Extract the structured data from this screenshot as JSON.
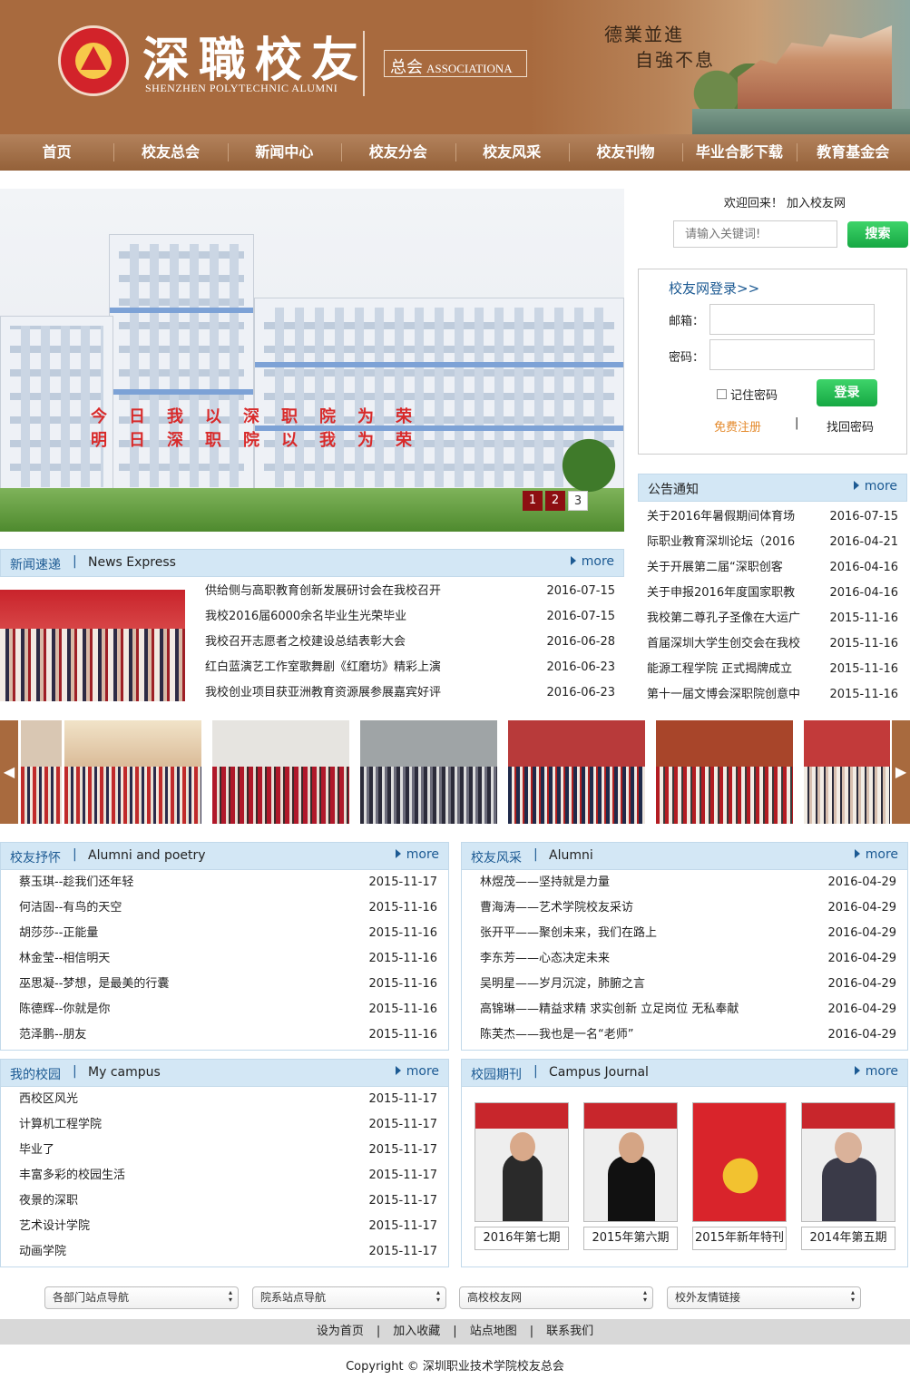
{
  "header": {
    "site_title": "深職校友",
    "site_subtitle": "SHENZHEN POLYTECHNIC ALUMNI",
    "assoc_zh": "总会",
    "assoc_en": "ASSOCIATIONA",
    "motto_line1": "德業並進",
    "motto_line2": "自強不息"
  },
  "nav": [
    "首页",
    "校友总会",
    "新闻中心",
    "校友分会",
    "校友风采",
    "校友刊物",
    "毕业合影下载",
    "教育基金会"
  ],
  "slider": {
    "slogan_line1": "今日我以深职院为荣",
    "slogan_line2": "明日深职院以我为荣",
    "pages": [
      "1",
      "2",
      "3"
    ],
    "active_page": "2"
  },
  "sidebar": {
    "welcome": "欢迎回来！ 加入校友网",
    "search_placeholder": "请输入关键词!",
    "search_button": "搜索",
    "login_title": "校友网登录>>",
    "email_label": "邮箱：",
    "password_label": "密码：",
    "remember_label": "记住密码",
    "login_button": "登录",
    "register_link": "免费注册",
    "separator": "|",
    "forgot_link": "找回密码"
  },
  "notice": {
    "title": "公告通知",
    "more": "more",
    "items": [
      {
        "title": "关于2016年暑假期间体育场",
        "date": "2016-07-15"
      },
      {
        "title": "际职业教育深圳论坛（2016",
        "date": "2016-04-21"
      },
      {
        "title": "关于开展第二届“深职创客",
        "date": "2016-04-16"
      },
      {
        "title": "关于申报2016年度国家职教",
        "date": "2016-04-16"
      },
      {
        "title": "我校第二尊孔子圣像在大运广",
        "date": "2015-11-16"
      },
      {
        "title": "首届深圳大学生创交会在我校",
        "date": "2015-11-16"
      },
      {
        "title": "能源工程学院 正式揭牌成立",
        "date": "2015-11-16"
      },
      {
        "title": "第十一届文博会深职院创意中",
        "date": "2015-11-16"
      }
    ]
  },
  "news": {
    "title_zh": "新闻速递",
    "separator": "|",
    "title_en": "News Express",
    "more": "more",
    "items": [
      {
        "title": "供给侧与高职教育创新发展研讨会在我校召开",
        "date": "2016-07-15"
      },
      {
        "title": "我校2016届6000余名毕业生光荣毕业",
        "date": "2016-07-15"
      },
      {
        "title": "我校召开志愿者之校建设总结表彰大会",
        "date": "2016-06-28"
      },
      {
        "title": "红白蓝演艺工作室歌舞剧《红磨坊》精彩上演",
        "date": "2016-06-23"
      },
      {
        "title": "我校创业项目获亚洲教育资源展参展嘉宾好评",
        "date": "2016-06-23"
      }
    ]
  },
  "gallery": {
    "left_arrow": "◀",
    "right_arrow": "▶"
  },
  "poetry": {
    "title_zh": "校友抒怀",
    "separator": "|",
    "title_en": "Alumni and poetry",
    "more": "more",
    "items": [
      {
        "title": "蔡玉琪--趁我们还年轻",
        "date": "2015-11-17"
      },
      {
        "title": "何洁固--有鸟的天空",
        "date": "2015-11-16"
      },
      {
        "title": "胡莎莎--正能量",
        "date": "2015-11-16"
      },
      {
        "title": "林金莹--相信明天",
        "date": "2015-11-16"
      },
      {
        "title": "巫思凝--梦想，是最美的行囊",
        "date": "2015-11-16"
      },
      {
        "title": "陈德辉--你就是你",
        "date": "2015-11-16"
      },
      {
        "title": "范泽鹏--朋友",
        "date": "2015-11-16"
      }
    ]
  },
  "alumni": {
    "title_zh": "校友风采",
    "separator": "|",
    "title_en": "Alumni",
    "more": "more",
    "items": [
      {
        "title": "林煜茂——坚持就是力量",
        "date": "2016-04-29"
      },
      {
        "title": "曹海涛——艺术学院校友采访",
        "date": "2016-04-29"
      },
      {
        "title": "张开平——聚创未来，我们在路上",
        "date": "2016-04-29"
      },
      {
        "title": "李东芳——心态决定未来",
        "date": "2016-04-29"
      },
      {
        "title": "吴明星——岁月沉淀，肺腑之言",
        "date": "2016-04-29"
      },
      {
        "title": "高锦琳——精益求精 求实创新 立足岗位 无私奉献",
        "date": "2016-04-29"
      },
      {
        "title": "陈芙杰——我也是一名“老师”",
        "date": "2016-04-29"
      }
    ]
  },
  "campus": {
    "title_zh": "我的校园",
    "separator": "|",
    "title_en": "My campus",
    "more": "more",
    "items": [
      {
        "title": "西校区风光",
        "date": "2015-11-17"
      },
      {
        "title": "计算机工程学院",
        "date": "2015-11-17"
      },
      {
        "title": "毕业了",
        "date": "2015-11-17"
      },
      {
        "title": "丰富多彩的校园生活",
        "date": "2015-11-17"
      },
      {
        "title": "夜景的深职",
        "date": "2015-11-17"
      },
      {
        "title": "艺术设计学院",
        "date": "2015-11-17"
      },
      {
        "title": "动画学院",
        "date": "2015-11-17"
      }
    ]
  },
  "journal": {
    "title_zh": "校园期刊",
    "separator": "|",
    "title_en": "Campus Journal",
    "more": "more",
    "items": [
      {
        "caption": "2016年第七期"
      },
      {
        "caption": "2015年第六期"
      },
      {
        "caption": "2015年新年特刊"
      },
      {
        "caption": "2014年第五期"
      }
    ]
  },
  "footer": {
    "selects": [
      "各部门站点导航",
      "院系站点导航",
      "高校校友网",
      "校外友情链接"
    ],
    "links": [
      "设为首页",
      "加入收藏",
      "站点地图",
      "联系我们"
    ],
    "link_sep": "|",
    "copyright": "Copyright © 深圳职业技术学院校友总会"
  },
  "colors": {
    "brand_brown": "#a86a3e",
    "accent_blue": "#1c5a93",
    "panel_head": "#d3e7f5",
    "button_green": "#16a843",
    "link_orange": "#e48a2c",
    "slider_active": "#8d0f12"
  }
}
